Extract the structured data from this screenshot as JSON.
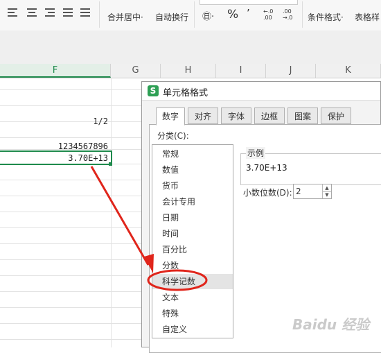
{
  "ribbon": {
    "merge_label": "合并居中·",
    "wrap_label": "自动换行",
    "percent_symbol": "%",
    "comma_symbol": "٬",
    "currency_symbol": "㊐·",
    "dec_inc": "←.0 .00",
    "dec_dec": ".00 →.0",
    "cond_format_label": "条件格式·",
    "table_style_label": "表格样"
  },
  "columns": [
    "F",
    "G",
    "H",
    "I",
    "J",
    "K"
  ],
  "cells": {
    "fraction": "1/2",
    "long_number": "1234567896",
    "scientific": "3.70E+13"
  },
  "dialog": {
    "title": "单元格格式",
    "app_icon_letter": "S",
    "tabs": [
      "数字",
      "对齐",
      "字体",
      "边框",
      "图案",
      "保护"
    ],
    "category_label": "分类(C):",
    "categories": [
      "常规",
      "数值",
      "货币",
      "会计专用",
      "日期",
      "时间",
      "百分比",
      "分数",
      "科学记数",
      "文本",
      "特殊",
      "自定义"
    ],
    "selected_category": "科学记数",
    "sample_label": "示例",
    "sample_value": "3.70E+13",
    "decimal_label": "小数位数(D):",
    "decimal_value": "2"
  },
  "colors": {
    "accent_green": "#1f8a4c",
    "annotation_red": "#e0251b"
  },
  "watermark": "Baidu 经验"
}
